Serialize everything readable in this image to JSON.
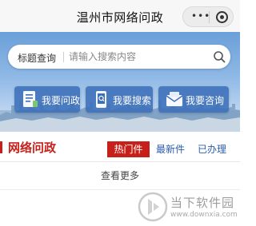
{
  "window": {
    "title": "温州市网络问政"
  },
  "capsule": {
    "more_icon": "ellipsis-icon",
    "close_icon": "target-circle-icon"
  },
  "search": {
    "label": "标题查询",
    "placeholder": "请输入搜索内容",
    "value": "",
    "icon": "search-icon"
  },
  "quick_actions": [
    {
      "label": "我要问政",
      "icon": "document-icon"
    },
    {
      "label": "我要搜索",
      "icon": "phone-search-icon"
    },
    {
      "label": "我要咨询",
      "icon": "mail-icon"
    }
  ],
  "section": {
    "title": "网络问政",
    "tabs": [
      {
        "label": "热门件",
        "active": true
      },
      {
        "label": "最新件",
        "active": false
      },
      {
        "label": "已办理",
        "active": false
      }
    ],
    "more_label": "查看更多"
  },
  "watermark": {
    "brand": "当下软件园",
    "url": "www.downxia.com"
  },
  "colors": {
    "accent_red": "#c7201a",
    "tab_blue": "#2a5db0",
    "button_blue": "#3c70ba"
  }
}
